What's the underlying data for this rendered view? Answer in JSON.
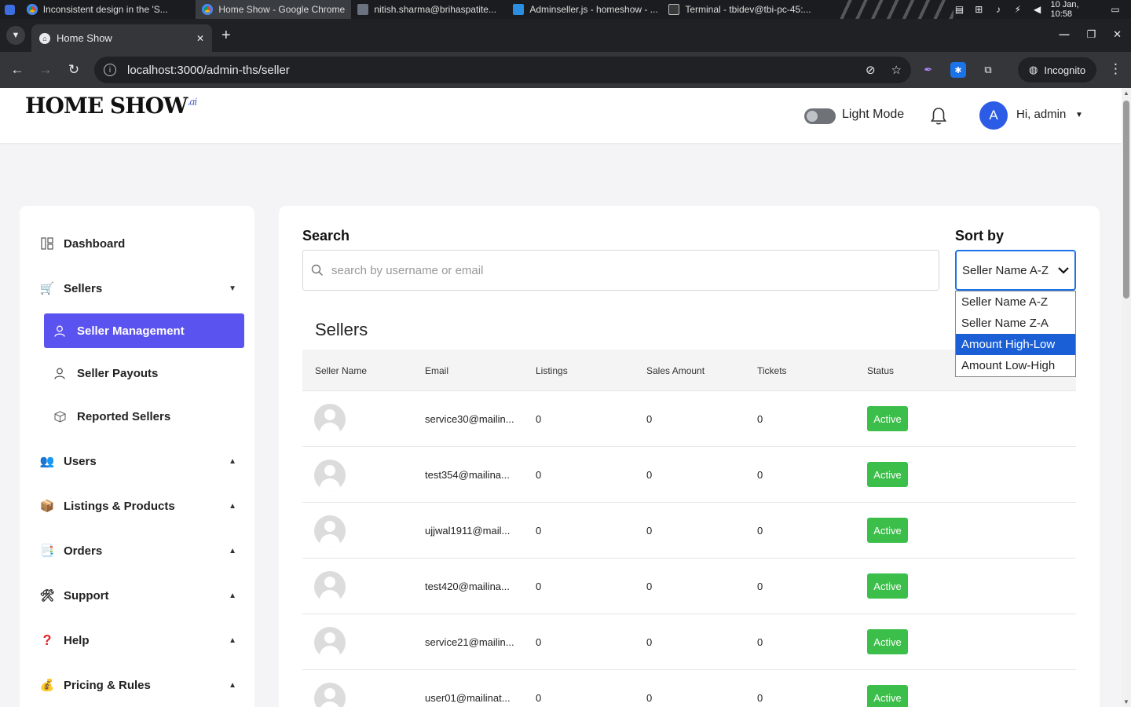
{
  "os": {
    "tasks": [
      {
        "label": "Inconsistent design in the 'S...",
        "icon": "chrome-icon"
      },
      {
        "label": "Home Show - Google Chrome",
        "icon": "chrome-icon"
      },
      {
        "label": "nitish.sharma@brihaspatite...",
        "icon": "mail-icon"
      },
      {
        "label": "Adminseller.js - homeshow - ...",
        "icon": "vscode-icon"
      },
      {
        "label": "Terminal - tbidev@tbi-pc-45:...",
        "icon": "terminal-icon"
      }
    ],
    "clock": "10 Jan, 10:58"
  },
  "browser": {
    "tab_title": "Home Show",
    "url": "localhost:3000/admin-ths/seller",
    "incognito_label": "Incognito"
  },
  "header": {
    "logo_text": "HOME SHOW",
    "logo_suffix": ".ai",
    "mode_label": "Light Mode",
    "avatar_initial": "A",
    "greeting": "Hi, admin"
  },
  "sidebar": {
    "dashboard": "Dashboard",
    "sellers": "Sellers",
    "seller_management": "Seller Management",
    "seller_payouts": "Seller Payouts",
    "reported_sellers": "Reported Sellers",
    "users": "Users",
    "listings": "Listings & Products",
    "orders": "Orders",
    "support": "Support",
    "help": "Help",
    "pricing": "Pricing & Rules"
  },
  "main": {
    "search_label": "Search",
    "search_placeholder": "search by username or email",
    "sort_label": "Sort by",
    "sort_value": "Seller Name A-Z",
    "sort_options": [
      "Seller Name A-Z",
      "Seller Name Z-A",
      "Amount High-Low",
      "Amount Low-High"
    ],
    "sort_highlighted": "Amount High-Low",
    "sellers_title": "Sellers",
    "columns": [
      "Seller Name",
      "Email",
      "Listings",
      "Sales Amount",
      "Tickets",
      "Status"
    ],
    "rows": [
      {
        "email": "service30@mailin...",
        "listings": "0",
        "sales": "0",
        "tickets": "0",
        "status": "Active"
      },
      {
        "email": "test354@mailina...",
        "listings": "0",
        "sales": "0",
        "tickets": "0",
        "status": "Active"
      },
      {
        "email": "ujjwal1911@mail...",
        "listings": "0",
        "sales": "0",
        "tickets": "0",
        "status": "Active"
      },
      {
        "email": "test420@mailina...",
        "listings": "0",
        "sales": "0",
        "tickets": "0",
        "status": "Active"
      },
      {
        "email": "service21@mailin...",
        "listings": "0",
        "sales": "0",
        "tickets": "0",
        "status": "Active"
      },
      {
        "email": "user01@mailinat...",
        "listings": "0",
        "sales": "0",
        "tickets": "0",
        "status": "Active"
      }
    ]
  },
  "colors": {
    "accent": "#5b53ef",
    "status_active": "#3cbf4a",
    "avatar": "#2c5be6",
    "select_focus": "#1a73e8"
  }
}
